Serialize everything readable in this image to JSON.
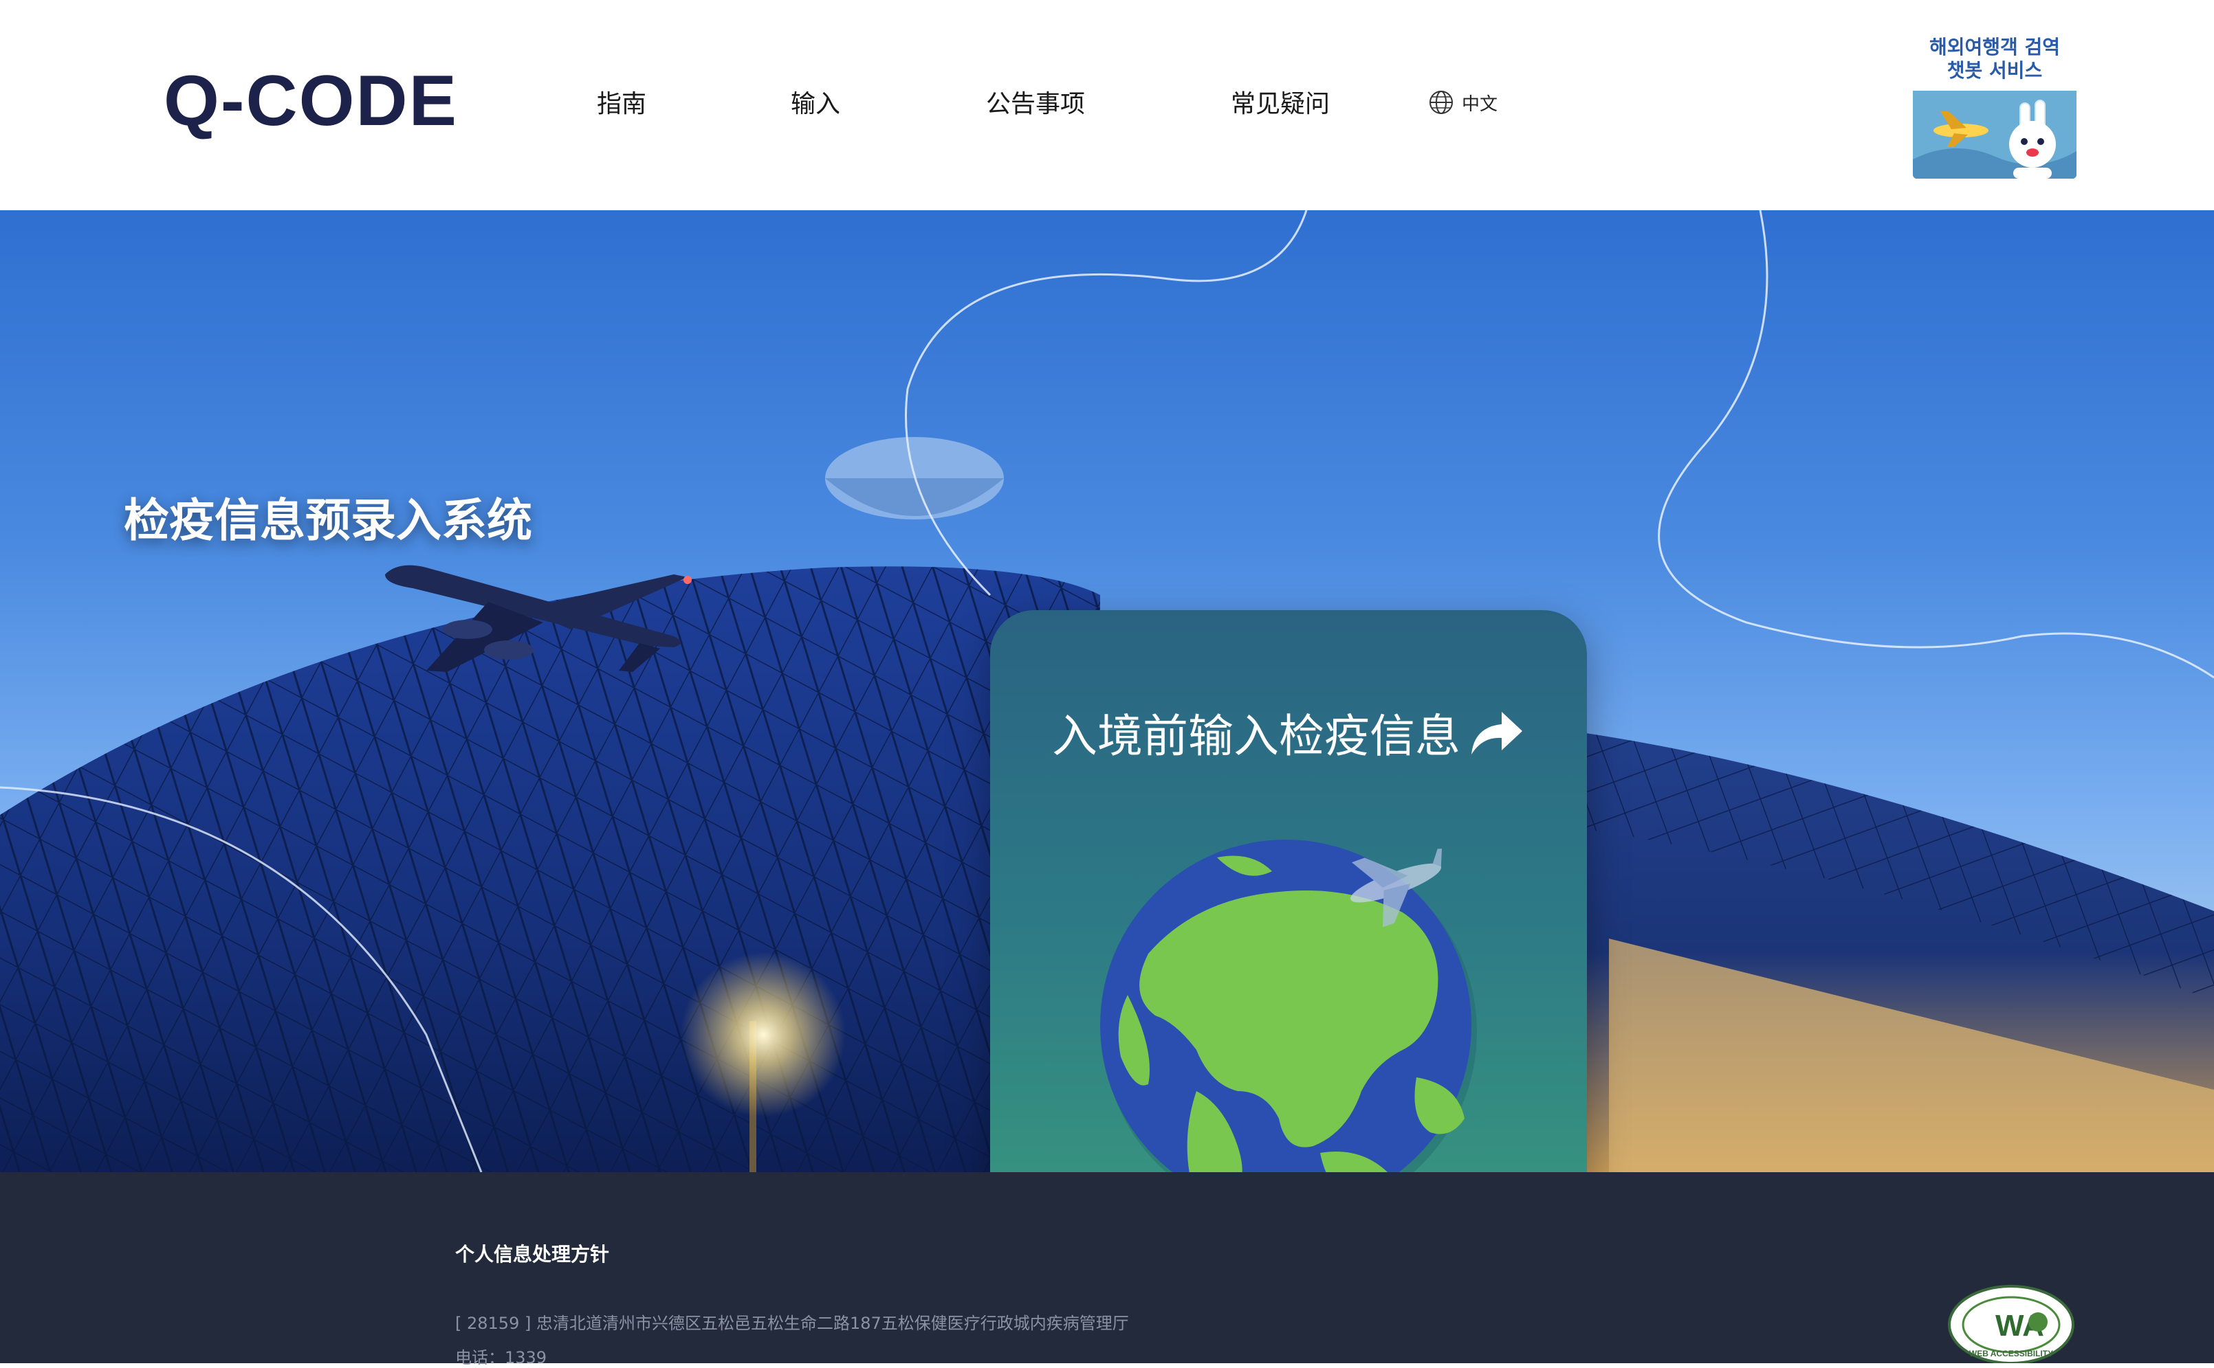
{
  "header": {
    "logo": "Q-CODE",
    "nav": [
      "指南",
      "输入",
      "公告事项",
      "常见疑问"
    ],
    "language": "中文",
    "chatbot": {
      "line1": "해외여행객 검역",
      "line2": "챗봇 서비스"
    }
  },
  "hero": {
    "title": "检疫信息预录入系统",
    "card_link": "入境前输入检疫信息"
  },
  "footer": {
    "policy": "个人信息处理方针",
    "address": "[ 28159 ] 忠清北道清州市兴德区五松邑五松生命二路187五松保健医疗行政城内疾病管理厅",
    "phone": "电话：1339",
    "badge_text": "WEB ACCESSIBILITY",
    "badge_mark": "WA"
  },
  "icons": {
    "globe": "globe-icon",
    "share": "share-arrow-icon",
    "earth": "earth-illustration",
    "airplane": "airplane-icon",
    "ship": "cruise-ship-icon"
  },
  "colors": {
    "brand_navy": "#1c2249",
    "brand_red": "#e8394e",
    "card_teal": "#2d7a86",
    "footer_bg": "#232a3c",
    "earth_ocean": "#2a4fb0",
    "earth_land": "#7ac74f"
  }
}
